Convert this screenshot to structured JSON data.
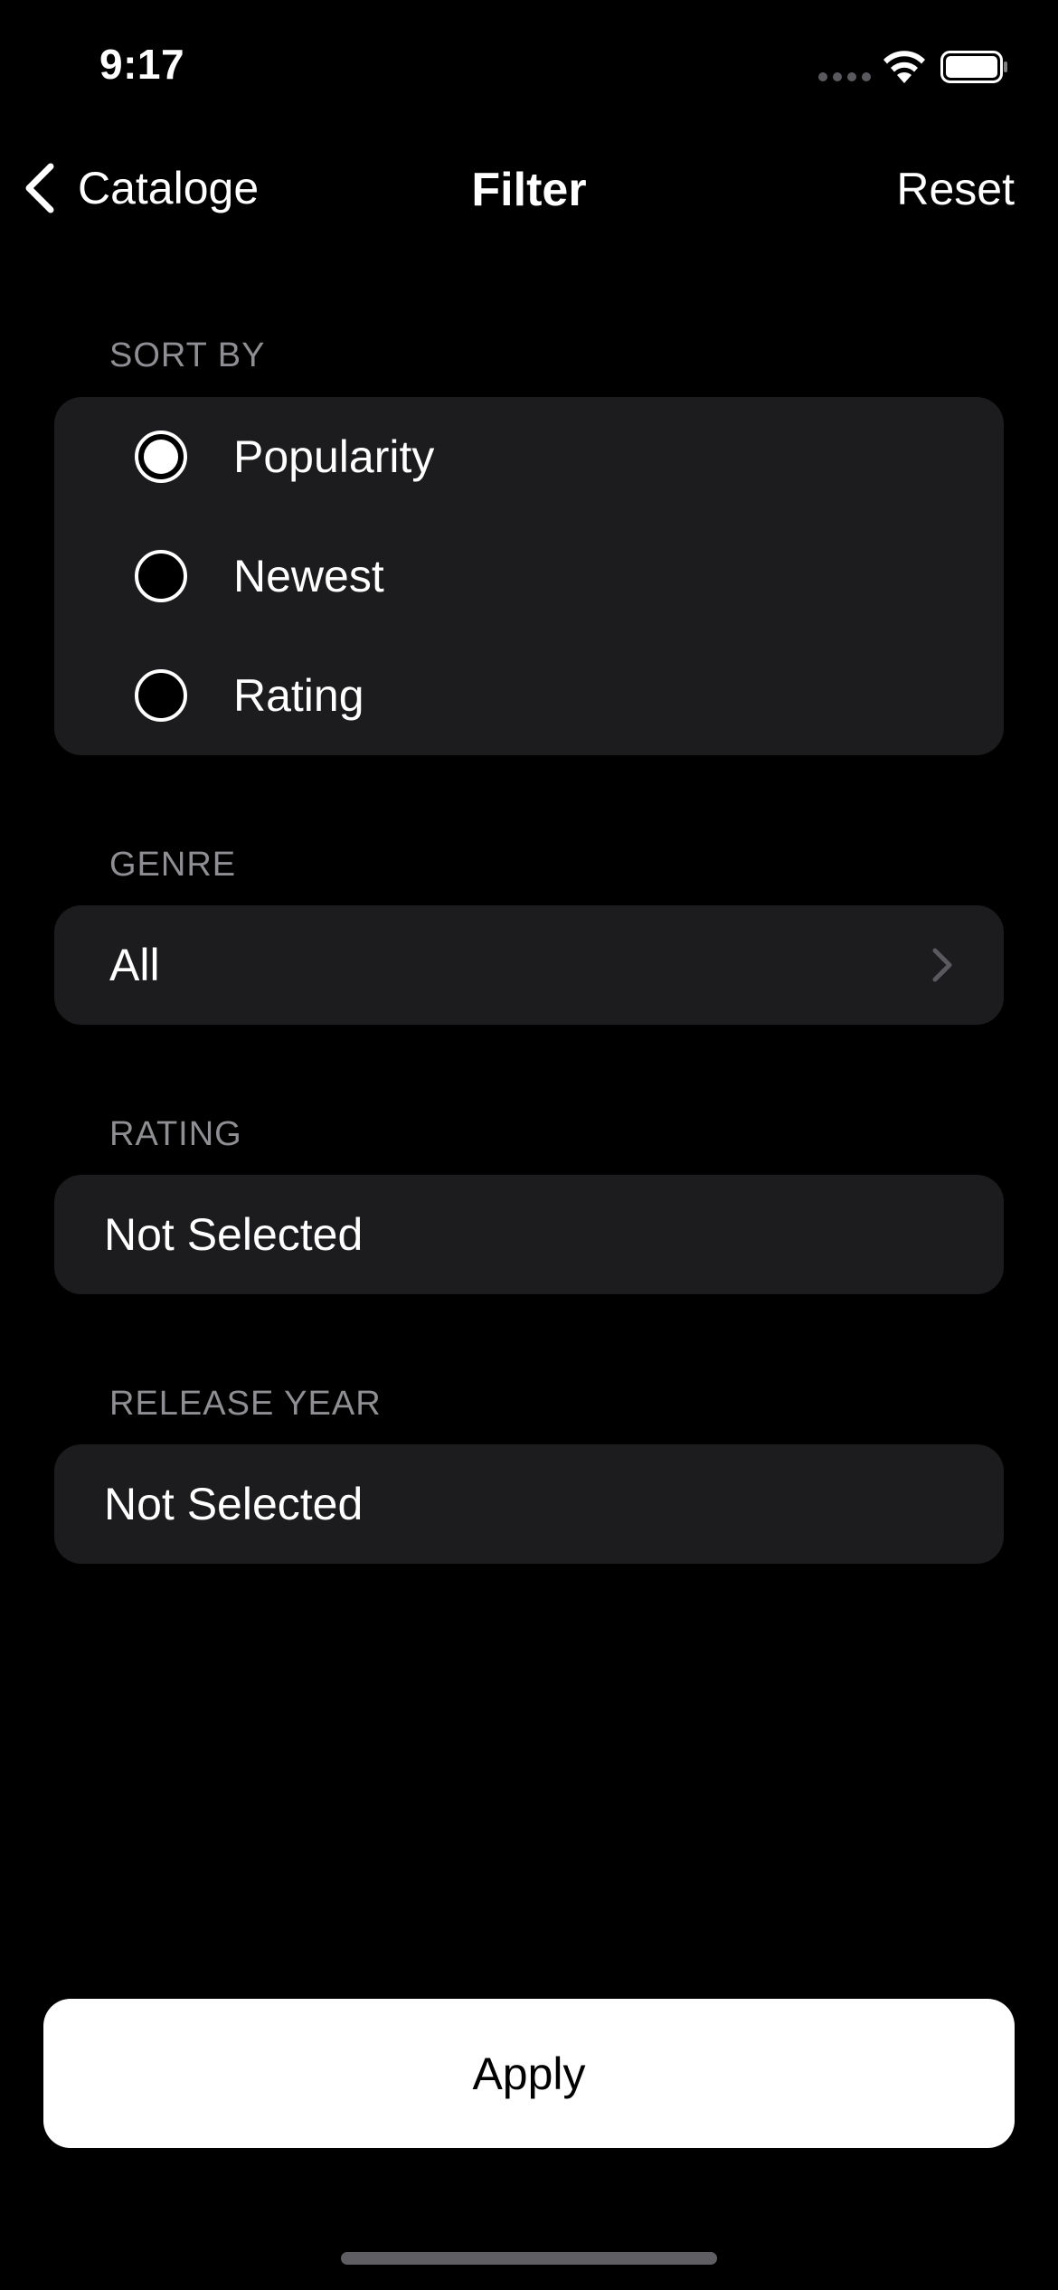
{
  "status_bar": {
    "time": "9:17"
  },
  "nav": {
    "back_label": "Catalоge",
    "title": "Filter",
    "reset_label": "Reset"
  },
  "sort_by": {
    "header": "SORT BY",
    "options": [
      {
        "label": "Popularity",
        "selected": true
      },
      {
        "label": "Newest",
        "selected": false
      },
      {
        "label": "Rating",
        "selected": false
      }
    ]
  },
  "genre": {
    "header": "GENRE",
    "value": "All"
  },
  "rating": {
    "header": "RATING",
    "value": "Not Selected"
  },
  "release_year": {
    "header": "RELEASE YEAR",
    "value": "Not Selected"
  },
  "apply": {
    "label": "Apply"
  },
  "colors": {
    "background": "#000000",
    "card": "#1c1c1e",
    "section_header": "#8e8e93",
    "apply_button": "#ffffff"
  },
  "icons": {
    "back": "chevron-left-icon",
    "disclosure": "chevron-right-icon",
    "wifi": "wifi-icon",
    "battery": "battery-icon",
    "signal": "signal-icon"
  }
}
